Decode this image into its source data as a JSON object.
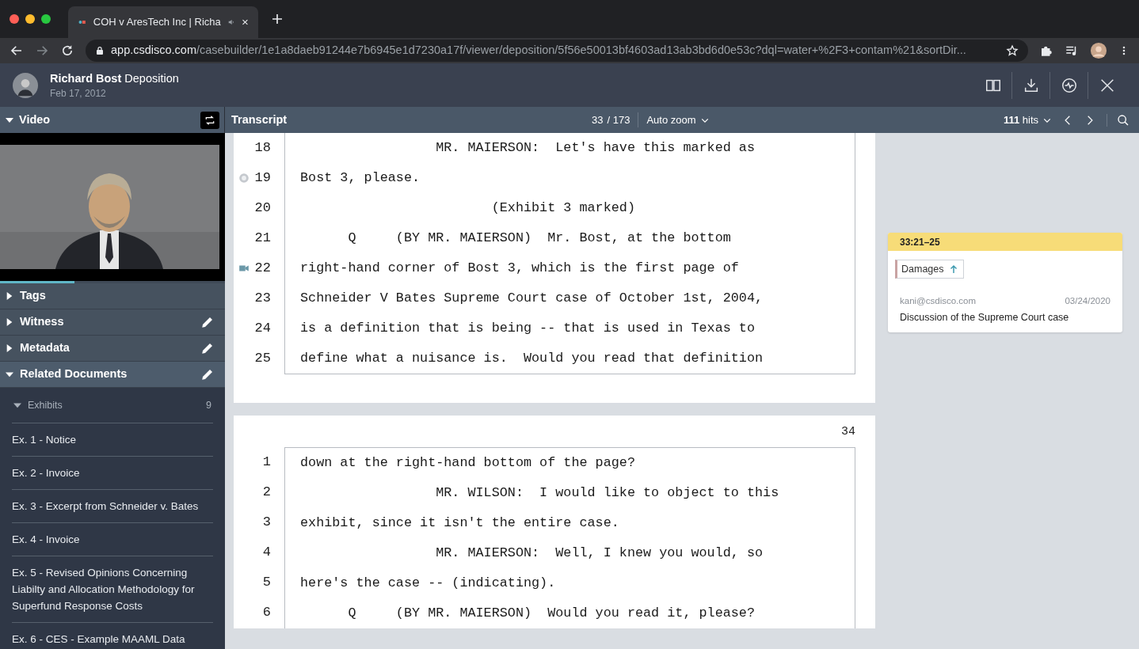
{
  "browser": {
    "tab_title": "COH v AresTech Inc | Richa",
    "url_host": "app.csdisco.com",
    "url_path": "/casebuilder/1e1a8daeb91244e7b6945e1d7230a17f/viewer/deposition/5f56e50013bf4603ad13ab3bd6d0e53c?dql=water+%2F3+contam%21&sortDir..."
  },
  "header": {
    "name": "Richard Bost",
    "doc_type": "Deposition",
    "date": "Feb 17, 2012"
  },
  "video_panel": {
    "title": "Video",
    "expanded": true,
    "progress": {
      "level": 0.33
    }
  },
  "toolbar": {
    "title": "Transcript",
    "page": "33",
    "page_total": "/ 173",
    "zoom": "Auto zoom",
    "hits_count": "111",
    "hits_label": "hits"
  },
  "sections": [
    {
      "label": "Tags",
      "expanded": false,
      "editable": false
    },
    {
      "label": "Witness",
      "expanded": false,
      "editable": true
    },
    {
      "label": "Metadata",
      "expanded": false,
      "editable": true
    },
    {
      "label": "Related Documents",
      "expanded": true,
      "editable": true
    }
  ],
  "exhibits": {
    "label": "Exhibits",
    "count": "9",
    "expanded": true,
    "items": [
      "Ex. 1 - Notice",
      "Ex. 2 - Invoice",
      "Ex. 3 - Excerpt from Schneider v. Bates",
      "Ex. 4 - Invoice",
      "Ex. 5 - Revised Opinions Concerning Liabilty and Allocation Methodology for Superfund Response Costs",
      "Ex. 6 - CES - Example MAAML Data"
    ]
  },
  "pages": [
    {
      "lines": [
        {
          "kind": "plain",
          "number": "18",
          "text": "                 MR. MAIERSON:  Let's have this marked as"
        },
        {
          "kind": "bookmarked",
          "number": "19",
          "text": "Bost 3, please."
        },
        {
          "kind": "plain",
          "number": "20",
          "text": "                        (Exhibit 3 marked)"
        },
        {
          "kind": "plain",
          "number": "21",
          "text": "      Q     (BY MR. MAIERSON)  Mr. Bost, at the bottom"
        },
        {
          "kind": "clip",
          "number": "22",
          "text": "right-hand corner of Bost 3, which is the first page of"
        },
        {
          "kind": "plain",
          "number": "23",
          "text": "Schneider V Bates Supreme Court case of October 1st, 2004,"
        },
        {
          "kind": "plain",
          "number": "24",
          "text": "is a definition that is being -- that is used in Texas to"
        },
        {
          "kind": "plain",
          "number": "25",
          "text": "define what a nuisance is.  Would you read that definition"
        }
      ]
    },
    {
      "page_number": "34",
      "lines": [
        {
          "kind": "plain",
          "number": "1",
          "text": "down at the right-hand bottom of the page?"
        },
        {
          "kind": "plain",
          "number": "2",
          "text": "                 MR. WILSON:  I would like to object to this"
        },
        {
          "kind": "plain",
          "number": "3",
          "text": "exhibit, since it isn't the entire case."
        },
        {
          "kind": "plain",
          "number": "4",
          "text": "                 MR. MAIERSON:  Well, I knew you would, so"
        },
        {
          "kind": "plain",
          "number": "5",
          "text": "here's the case -- (indicating)."
        },
        {
          "kind": "plain",
          "number": "6",
          "text": "      Q     (BY MR. MAIERSON)  Would you read it, please?"
        }
      ]
    }
  ],
  "annotation": {
    "range": "33:21–25",
    "tag": {
      "label": "Damages",
      "color": "#c9a3a3"
    },
    "author": "kani@csdisco.com",
    "date": "03/24/2020",
    "comment": "Discussion of the Supreme Court case"
  }
}
